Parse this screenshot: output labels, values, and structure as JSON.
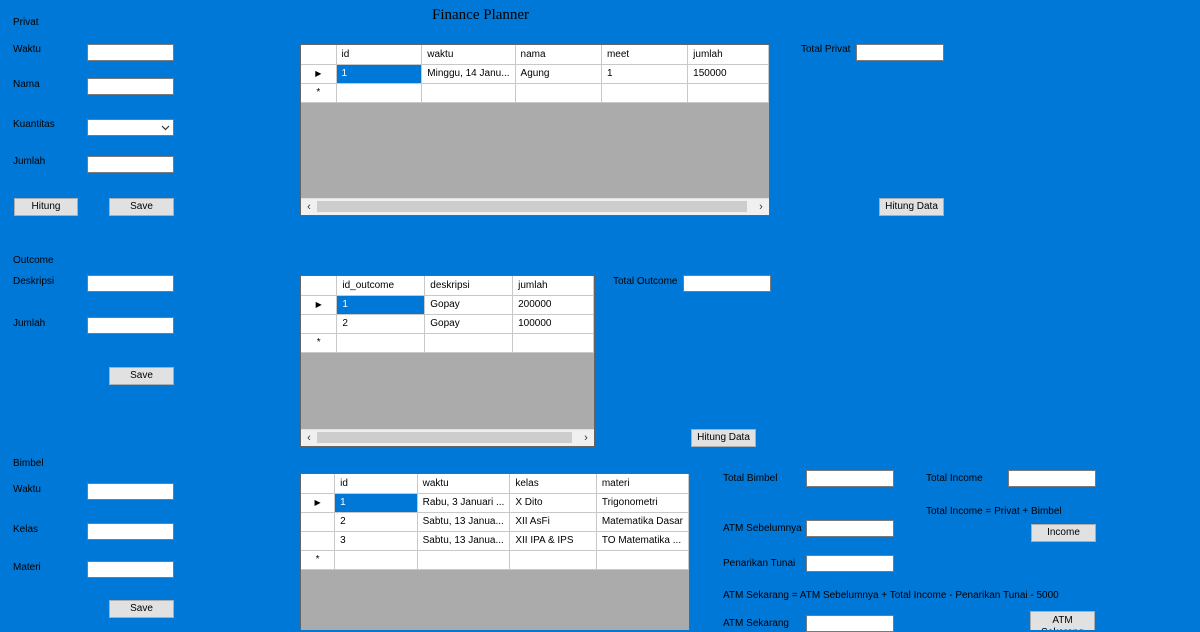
{
  "app": {
    "title": "Finance Planner"
  },
  "privat": {
    "section_label": "Privat",
    "waktu_label": "Waktu",
    "nama_label": "Nama",
    "kuantitas_label": "Kuantitas",
    "jumlah_label": "Jumlah",
    "hitung_button": "Hitung",
    "save_button": "Save",
    "total_label": "Total Privat",
    "hitung_data_button": "Hitung Data",
    "grid": {
      "columns": [
        "id",
        "waktu",
        "nama",
        "meet",
        "jumlah"
      ],
      "rows": [
        [
          "1",
          "Minggu, 14 Janu...",
          "Agung",
          "1",
          "150000"
        ]
      ],
      "new_row_marker": "*",
      "current_row_marker": "▶"
    }
  },
  "outcome": {
    "section_label": "Outcome",
    "deskripsi_label": "Deskripsi",
    "jumlah_label": "Jumlah",
    "save_button": "Save",
    "total_label": "Total Outcome",
    "hitung_data_button": "Hitung Data",
    "grid": {
      "columns": [
        "id_outcome",
        "deskripsi",
        "jumlah"
      ],
      "rows": [
        [
          "1",
          "Gopay",
          "200000"
        ],
        [
          "2",
          "Gopay",
          "100000"
        ]
      ],
      "new_row_marker": "*",
      "current_row_marker": "▶"
    }
  },
  "bimbel": {
    "section_label": "Bimbel",
    "waktu_label": "Waktu",
    "kelas_label": "Kelas",
    "materi_label": "Materi",
    "save_button": "Save",
    "grid": {
      "columns": [
        "id",
        "waktu",
        "kelas",
        "materi"
      ],
      "rows": [
        [
          "1",
          "Rabu, 3 Januari ...",
          "X Dito",
          "Trigonometri"
        ],
        [
          "2",
          "Sabtu, 13 Janua...",
          "XII AsFi",
          "Matematika Dasar"
        ],
        [
          "3",
          "Sabtu, 13 Janua...",
          "XII IPA & IPS",
          "TO Matematika ..."
        ]
      ],
      "new_row_marker": "*",
      "current_row_marker": "▶"
    }
  },
  "summary": {
    "total_bimbel_label": "Total Bimbel",
    "total_income_label": "Total Income",
    "income_formula": "Total Income = Privat + Bimbel",
    "income_button": "Income",
    "atm_sebelumnya_label": "ATM Sebelumnya",
    "penarikan_label": "Penarikan Tunai",
    "atm_formula": "ATM Sekarang = ATM Sebelumnya + Total Income - Penarikan Tunai - 5000",
    "atm_sekarang_label": "ATM Sekarang",
    "atm_button": "ATM Sekarang"
  },
  "colors": {
    "background": "#0078d7",
    "selection": "#0078d7",
    "grid_empty": "#ababab"
  }
}
